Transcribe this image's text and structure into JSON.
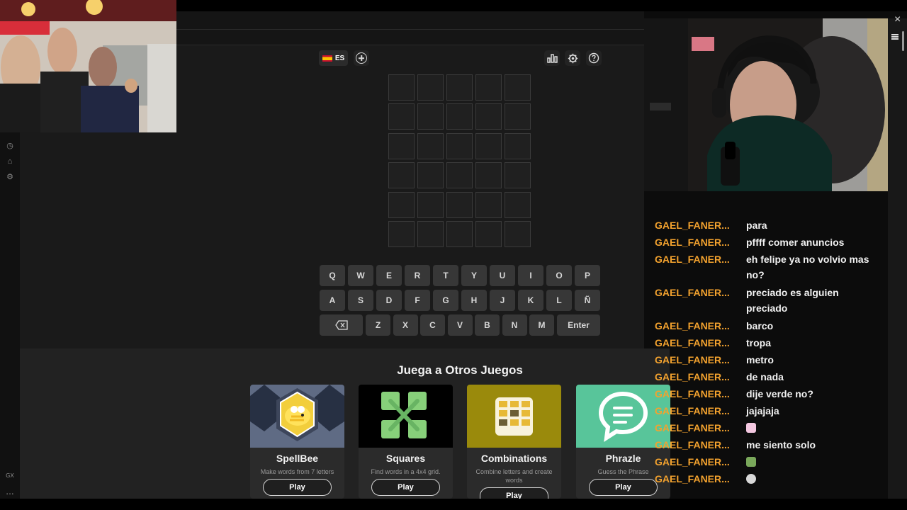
{
  "language": {
    "code": "ES"
  },
  "keyboard": {
    "row1": [
      "Q",
      "W",
      "E",
      "R",
      "T",
      "Y",
      "U",
      "I",
      "O",
      "P"
    ],
    "row2": [
      "A",
      "S",
      "D",
      "F",
      "G",
      "H",
      "J",
      "K",
      "L",
      "Ñ"
    ],
    "row3": [
      "Z",
      "X",
      "C",
      "V",
      "B",
      "N",
      "M"
    ],
    "enter_label": "Enter"
  },
  "other_games": {
    "title": "Juega a Otros Juegos",
    "cards": [
      {
        "name": "SpellBee",
        "description": "Make words from 7 letters",
        "play_label": "Play"
      },
      {
        "name": "Squares",
        "description": "Find words in a 4x4 grid.",
        "play_label": "Play"
      },
      {
        "name": "Combinations",
        "description": "Combine letters and create words",
        "play_label": "Play"
      },
      {
        "name": "Phrazle",
        "description": "Guess the Phrase",
        "play_label": "Play"
      }
    ]
  },
  "sidebar": {
    "gx_label": "GX",
    "more_label": "..."
  },
  "chat": {
    "messages": [
      {
        "user": "GAEL_FANER...",
        "text": "para"
      },
      {
        "user": "GAEL_FANER...",
        "text": "pffff comer anuncios"
      },
      {
        "user": "GAEL_FANER...",
        "text": "eh felipe ya no volvio mas no?"
      },
      {
        "user": "GAEL_FANER...",
        "text": "preciado es alguien preciado"
      },
      {
        "user": "GAEL_FANER...",
        "text": "barco"
      },
      {
        "user": "GAEL_FANER...",
        "text": "tropa"
      },
      {
        "user": "GAEL_FANER...",
        "text": "metro"
      },
      {
        "user": "GAEL_FANER...",
        "text": "de nada"
      },
      {
        "user": "GAEL_FANER...",
        "text": "dije verde no?"
      },
      {
        "user": "GAEL_FANER...",
        "text": "jajajaja"
      },
      {
        "user": "GAEL_FANER...",
        "text": ""
      },
      {
        "user": "GAEL_FANER...",
        "text": "me siento solo"
      },
      {
        "user": "GAEL_FANER...",
        "text": ""
      },
      {
        "user": "GAEL_FANER...",
        "text": ""
      }
    ]
  },
  "colors": {
    "background": "#1a1a1a",
    "tile_border": "#3a3a3a",
    "key": "#373737",
    "chat_user": "#f3a22e",
    "spellbee_card": "#5f6b84",
    "combinations_card": "#9a8a0c",
    "phrazle_card": "#58c59a"
  }
}
